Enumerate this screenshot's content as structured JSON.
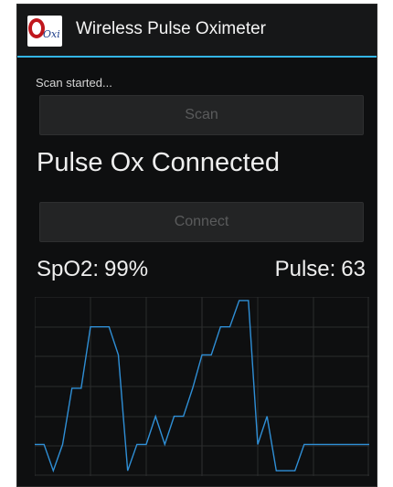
{
  "app": {
    "title": "Wireless Pulse Oximeter",
    "logo_text": "Oxi"
  },
  "status": {
    "scan_message": "Scan started...",
    "connection": "Pulse Ox Connected"
  },
  "buttons": {
    "scan_label": "Scan",
    "connect_label": "Connect"
  },
  "readings": {
    "spo2_label": "SpO2:",
    "spo2_value": "99%",
    "pulse_label": "Pulse:",
    "pulse_value": "63"
  },
  "colors": {
    "accent": "#33b5e5",
    "waveform": "#2f8fd6",
    "grid": "#2b2c2d",
    "logo_red": "#c0171d"
  },
  "chart_data": {
    "type": "line",
    "title": "",
    "xlabel": "",
    "ylabel": "",
    "grid": true,
    "xlim": [
      0,
      36
    ],
    "ylim": [
      0,
      10
    ],
    "series": [
      {
        "x": [
          0,
          1,
          2,
          3,
          4,
          5,
          6,
          7,
          8,
          9,
          10,
          11,
          12,
          13,
          14,
          15,
          16,
          17,
          18,
          19,
          20,
          21,
          22,
          23,
          24,
          25,
          26,
          27,
          28,
          29,
          30,
          31,
          32,
          33,
          34,
          35,
          36
        ],
        "values": [
          1.7,
          1.7,
          0.2,
          1.7,
          4.9,
          4.9,
          8.4,
          8.4,
          8.4,
          6.8,
          0.2,
          1.7,
          1.7,
          3.3,
          1.7,
          3.3,
          3.3,
          4.9,
          6.8,
          6.8,
          8.4,
          8.4,
          9.9,
          9.9,
          1.7,
          3.3,
          0.2,
          0.2,
          0.2,
          1.7,
          1.7,
          1.7,
          1.7,
          1.7,
          1.7,
          1.7,
          1.7
        ]
      }
    ]
  }
}
